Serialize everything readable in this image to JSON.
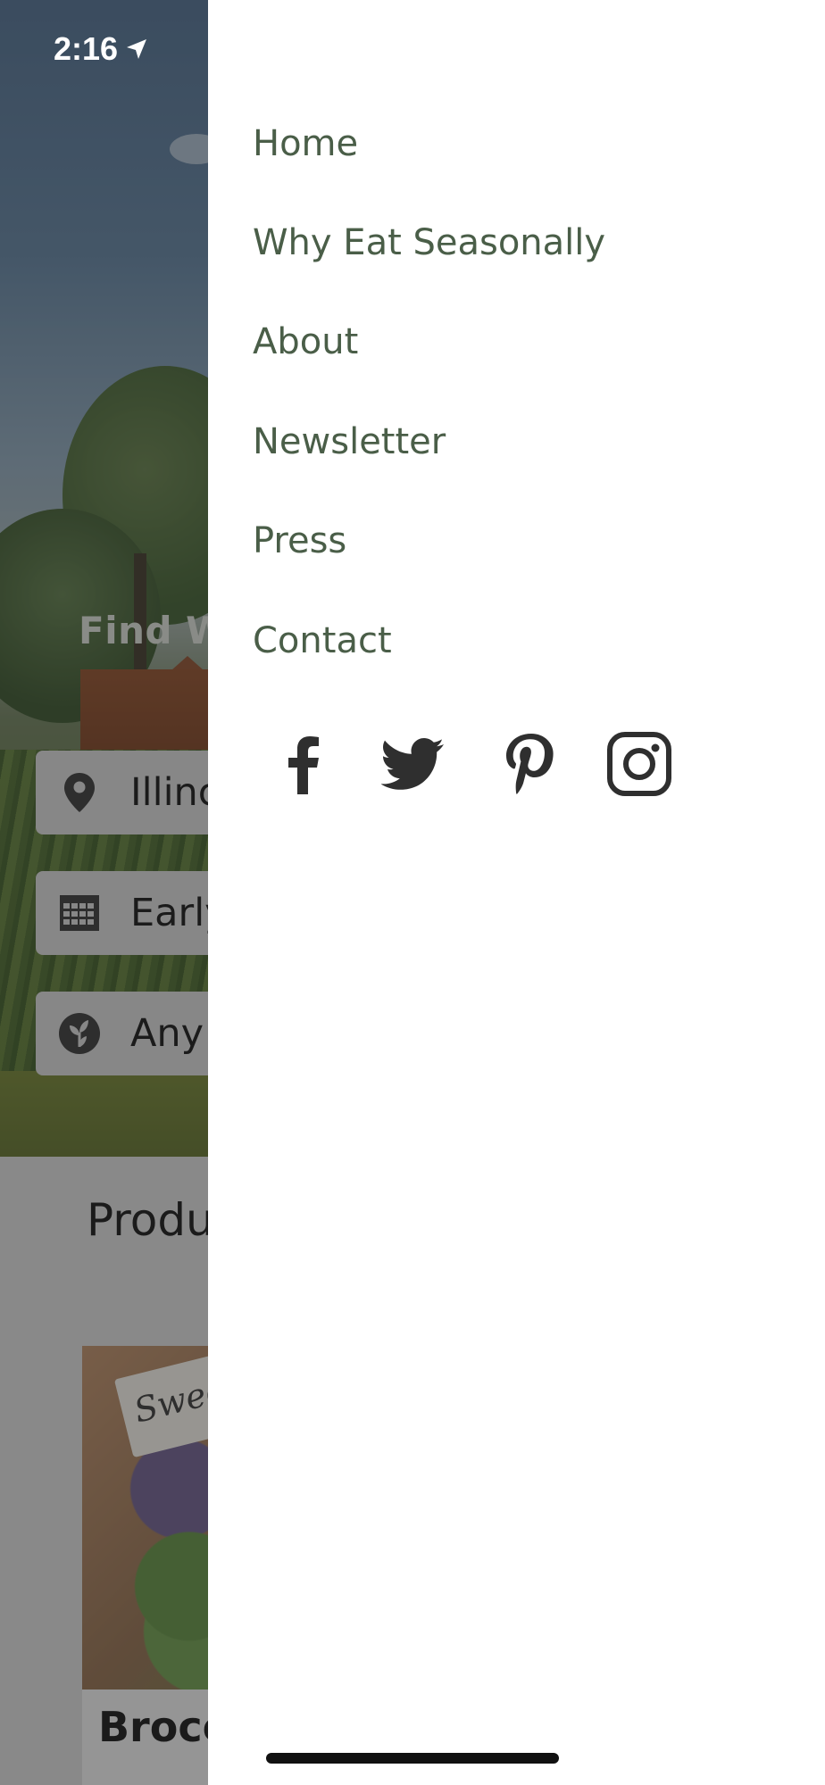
{
  "status_bar": {
    "time": "2:16"
  },
  "background": {
    "hero_title": "Find W",
    "filters": {
      "location": "Illinc",
      "season": "Early",
      "type": "Any"
    },
    "products_heading": "Produ",
    "product_card": {
      "sign": "Swee",
      "name": "Brocc"
    }
  },
  "drawer": {
    "menu": [
      "Home",
      "Why Eat Seasonally",
      "About",
      "Newsletter",
      "Press",
      "Contact"
    ],
    "social": [
      "facebook-icon",
      "twitter-icon",
      "pinterest-icon",
      "instagram-icon"
    ],
    "text_color": "#4a5e48",
    "icon_color": "#2f2f2f"
  }
}
